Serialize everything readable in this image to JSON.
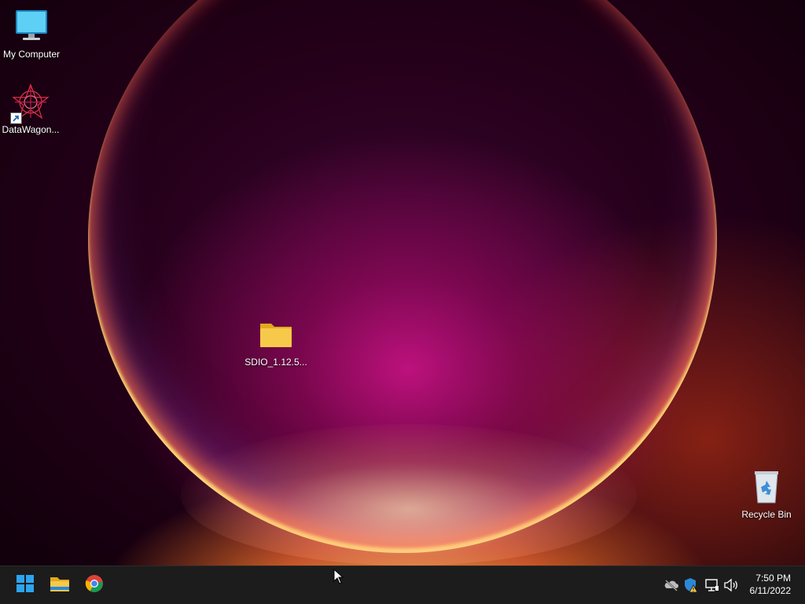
{
  "desktop": {
    "icons": [
      {
        "label": "My Computer",
        "icon": "computer-icon"
      },
      {
        "label": "DataWagon...",
        "icon": "datawagon-shortcut-icon"
      },
      {
        "label": "SDIO_1.12.5...",
        "icon": "folder-icon"
      },
      {
        "label": "Recycle Bin",
        "icon": "recycle-bin-icon"
      }
    ]
  },
  "taskbar": {
    "pinned": [
      {
        "name": "Start",
        "icon": "windows-start-icon"
      },
      {
        "name": "File Explorer",
        "icon": "file-explorer-icon"
      },
      {
        "name": "Google Chrome",
        "icon": "chrome-icon"
      }
    ],
    "tray": [
      {
        "icon": "onedrive-offline-icon"
      },
      {
        "icon": "windows-security-warning-icon"
      },
      {
        "icon": "network-icon"
      },
      {
        "icon": "volume-icon"
      }
    ],
    "clock": {
      "time": "7:50 PM",
      "date": "6/11/2022"
    }
  },
  "colors": {
    "taskbar_bg": "#1c1c1c",
    "accent_blue": "#0078d4",
    "folder_yellow": "#f6c94a"
  }
}
